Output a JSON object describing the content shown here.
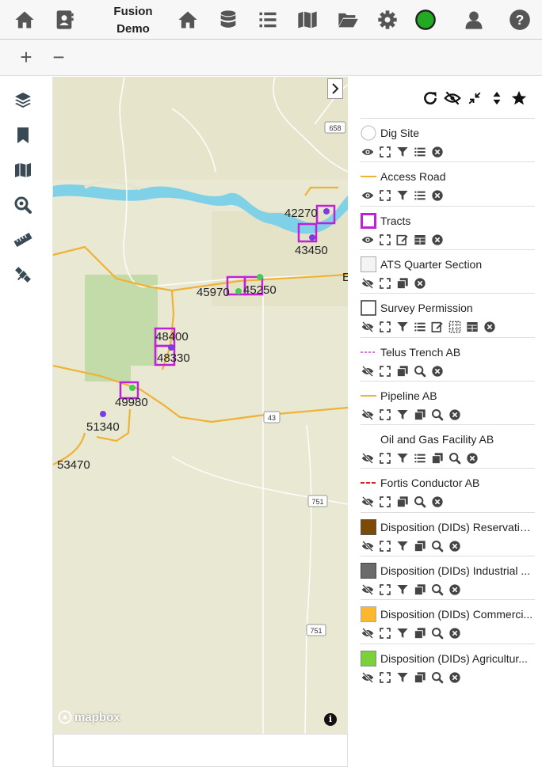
{
  "app": {
    "title_line1": "Fusion",
    "title_line2": "Demo"
  },
  "topbar": {
    "icons": [
      "home-icon",
      "address-book-icon",
      "home-icon",
      "database-icon",
      "list-icon",
      "map-icon",
      "folder-open-icon",
      "gear-icon",
      "status-indicator-icon",
      "user-icon",
      "help-icon"
    ],
    "status_color": "#22aa22"
  },
  "zoom": {
    "in_label": "+",
    "out_label": "−"
  },
  "sidebar": {
    "icons": [
      "layers-icon",
      "bookmark-icon",
      "map-icon",
      "zoom-search-icon",
      "ruler-icon",
      "satellite-icon"
    ]
  },
  "map": {
    "road_shields": [
      "658",
      "43",
      "751",
      "751"
    ],
    "tract_labels": [
      "42270",
      "43450",
      "45970",
      "45250",
      "48400",
      "48330",
      "49980",
      "51340",
      "53470"
    ],
    "edge_label": "E",
    "attribution": "mapbox",
    "info_label": "i",
    "colors": {
      "river": "#7fd1e8",
      "pipeline": "#f0b233",
      "tract": "#c020d8",
      "ag": "#b7d59a",
      "land": "#e9e8d3"
    }
  },
  "panel": {
    "tools": [
      "refresh-icon",
      "hide-all-icon",
      "collapse-icon",
      "sort-icon",
      "favorite-icon"
    ],
    "layers": [
      {
        "name": "Dig Site",
        "swatch": "circle-outline",
        "tools": [
          "eye",
          "extent",
          "filter",
          "list",
          "remove"
        ]
      },
      {
        "name": "Access Road",
        "swatch": "line-orange",
        "tools": [
          "eye",
          "extent",
          "filter",
          "list",
          "remove"
        ]
      },
      {
        "name": "Tracts",
        "swatch": "square-magenta",
        "tools": [
          "eye",
          "extent",
          "edit",
          "table",
          "remove"
        ]
      },
      {
        "name": "ATS Quarter Section",
        "swatch": "square-grey",
        "tools": [
          "eye-slash",
          "extent",
          "copy",
          "remove"
        ]
      },
      {
        "name": "Survey Permission",
        "swatch": "square-dark",
        "tools": [
          "eye-slash",
          "extent",
          "filter",
          "list",
          "edit",
          "grid",
          "table",
          "remove"
        ]
      },
      {
        "name": "Telus Trench AB",
        "swatch": "line-dashed-magenta",
        "tools": [
          "eye-slash",
          "extent",
          "copy",
          "search",
          "remove"
        ]
      },
      {
        "name": "Pipeline AB",
        "swatch": "line-orange",
        "tools": [
          "eye-slash",
          "extent",
          "filter",
          "copy",
          "search",
          "remove"
        ]
      },
      {
        "name": "Oil and Gas Facility AB",
        "swatch": "circle-white",
        "tools": [
          "eye-slash",
          "extent",
          "filter",
          "list",
          "copy",
          "search",
          "remove"
        ]
      },
      {
        "name": "Fortis Conductor AB",
        "swatch": "line-dashed-red",
        "tools": [
          "eye-slash",
          "extent",
          "copy",
          "search",
          "remove"
        ]
      },
      {
        "name": "Disposition (DIDs) Reservatio...",
        "swatch": "fill-brown",
        "tools": [
          "eye-slash",
          "extent",
          "filter",
          "copy",
          "search",
          "remove"
        ]
      },
      {
        "name": "Disposition (DIDs) Industrial ...",
        "swatch": "fill-grey",
        "tools": [
          "eye-slash",
          "extent",
          "filter",
          "copy",
          "search",
          "remove"
        ]
      },
      {
        "name": "Disposition (DIDs) Commerci...",
        "swatch": "fill-yellow",
        "tools": [
          "eye-slash",
          "extent",
          "filter",
          "copy",
          "search",
          "remove"
        ]
      },
      {
        "name": "Disposition (DIDs) Agricultur...",
        "swatch": "fill-green",
        "tools": [
          "eye-slash",
          "extent",
          "filter",
          "copy",
          "search",
          "remove"
        ]
      }
    ]
  }
}
